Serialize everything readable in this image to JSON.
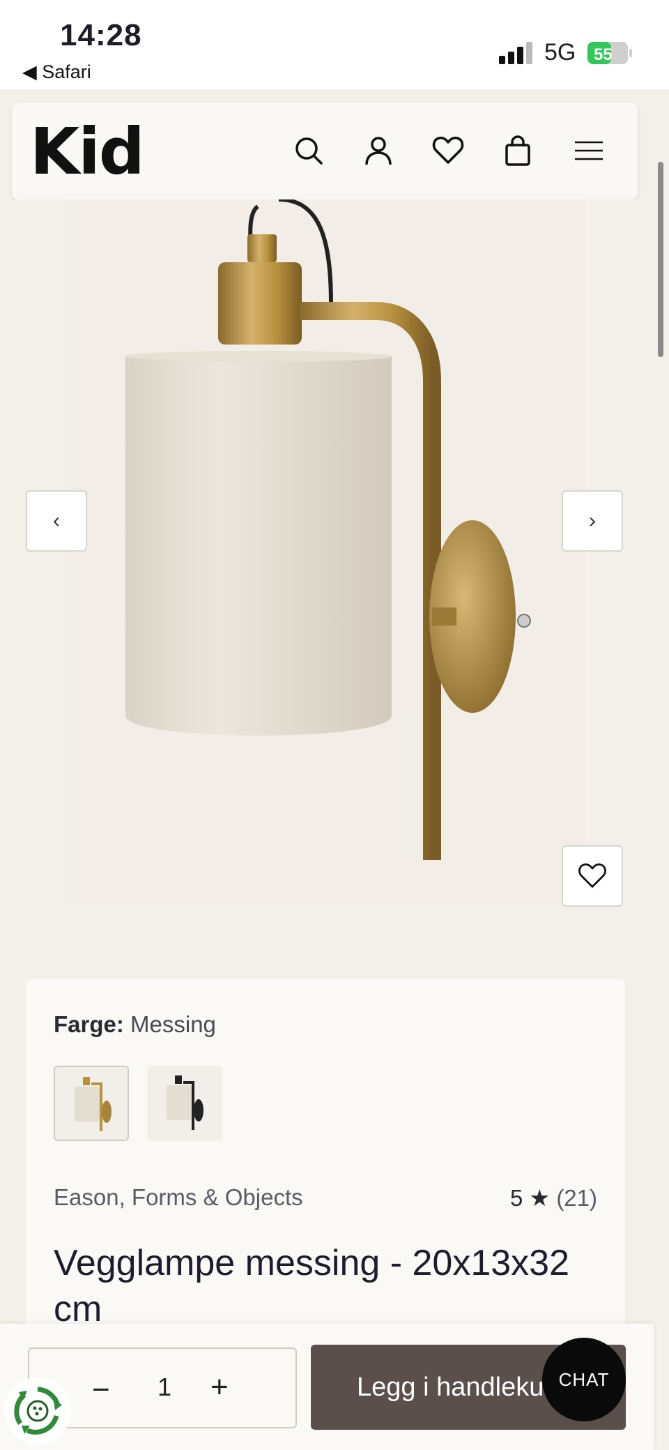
{
  "status_bar": {
    "time": "14:28",
    "back_app": "◀ Safari",
    "network": "5G",
    "battery": "55"
  },
  "header": {
    "logo": "Kid",
    "icons": [
      "search-icon",
      "account-icon",
      "wishlist-icon",
      "bag-icon",
      "menu-icon"
    ]
  },
  "gallery": {
    "prev_label": "‹",
    "next_label": "›"
  },
  "product": {
    "color_label": "Farge:",
    "color_value": "Messing",
    "brand": "Eason, Forms & Objects",
    "rating_value": "5 ★",
    "rating_count": "(21)",
    "title": "Vegglampe messing - 20x13x32 cm"
  },
  "purchase": {
    "minus": "−",
    "quantity": "1",
    "plus": "+",
    "add_to_cart": "Legg i handlekurv"
  },
  "chat": {
    "label": "CHAT"
  },
  "colors": {
    "accent": "#5a4f4a",
    "background": "#f3efe9",
    "brass": "#b8913f"
  }
}
